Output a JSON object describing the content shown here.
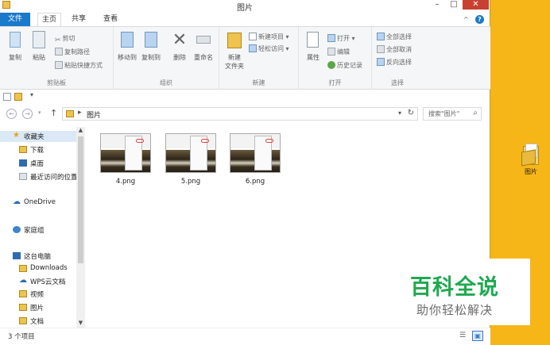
{
  "window": {
    "title": "图片",
    "min_glyph": "–",
    "max_glyph": "□",
    "close_glyph": "✕"
  },
  "tabs": {
    "file": "文件",
    "home": "主页",
    "share": "共享",
    "view": "查看",
    "collapse_glyph": "^",
    "help_glyph": "?"
  },
  "ribbon": {
    "clipboard": {
      "label": "剪贴板",
      "copy": "复制",
      "paste": "粘贴",
      "cut": "剪切",
      "copy_path": "复制路径",
      "paste_shortcut": "粘贴快捷方式"
    },
    "organize": {
      "label": "组织",
      "move_to": "移动到",
      "copy_to": "复制到",
      "delete": "删除",
      "rename": "重命名"
    },
    "new": {
      "label": "新建",
      "new_folder_line1": "新建",
      "new_folder_line2": "文件夹",
      "new_item": "新建项目 ▾",
      "easy_access": "轻松访问 ▾"
    },
    "open": {
      "label": "打开",
      "properties": "属性",
      "open": "打开 ▾",
      "edit": "编辑",
      "history": "历史记录"
    },
    "select": {
      "label": "选择",
      "select_all": "全部选择",
      "select_none": "全部取消",
      "invert": "反向选择"
    }
  },
  "qat": {
    "dropdown_glyph": "▾"
  },
  "address": {
    "back_glyph": "←",
    "forward_glyph": "→",
    "recent_glyph": "▾",
    "up_glyph": "↑",
    "chevron": "▸",
    "path": "图片",
    "dropdown_glyph": "▾",
    "refresh_glyph": "↻",
    "search_placeholder": "搜索\"图片\"",
    "search_glyph": "⌕"
  },
  "nav_pane": {
    "favorites": "收藏夹",
    "downloads_cn": "下载",
    "desktop": "桌面",
    "recent": "最近访问的位置",
    "onedrive": "OneDrive",
    "homegroup": "家庭组",
    "this_pc": "这台电脑",
    "downloads": "Downloads",
    "wps": "WPS云文档",
    "videos": "视频",
    "pictures": "图片",
    "documents": "文档",
    "scroll_up": "▲",
    "scroll_down": "▼"
  },
  "files": [
    {
      "name": "4.png"
    },
    {
      "name": "5.png"
    },
    {
      "name": "6.png"
    }
  ],
  "status": {
    "item_count": "3 个项目",
    "details_glyph": "☰",
    "icons_glyph": "▣"
  },
  "desktop": {
    "folder_label": "图片"
  },
  "watermark": {
    "title": "百科全说",
    "subtitle": "助你轻松解决"
  },
  "colors": {
    "accent": "#1979ca",
    "desktop": "#f6b617",
    "close": "#c84031",
    "watermark_green": "#1ea94f"
  }
}
